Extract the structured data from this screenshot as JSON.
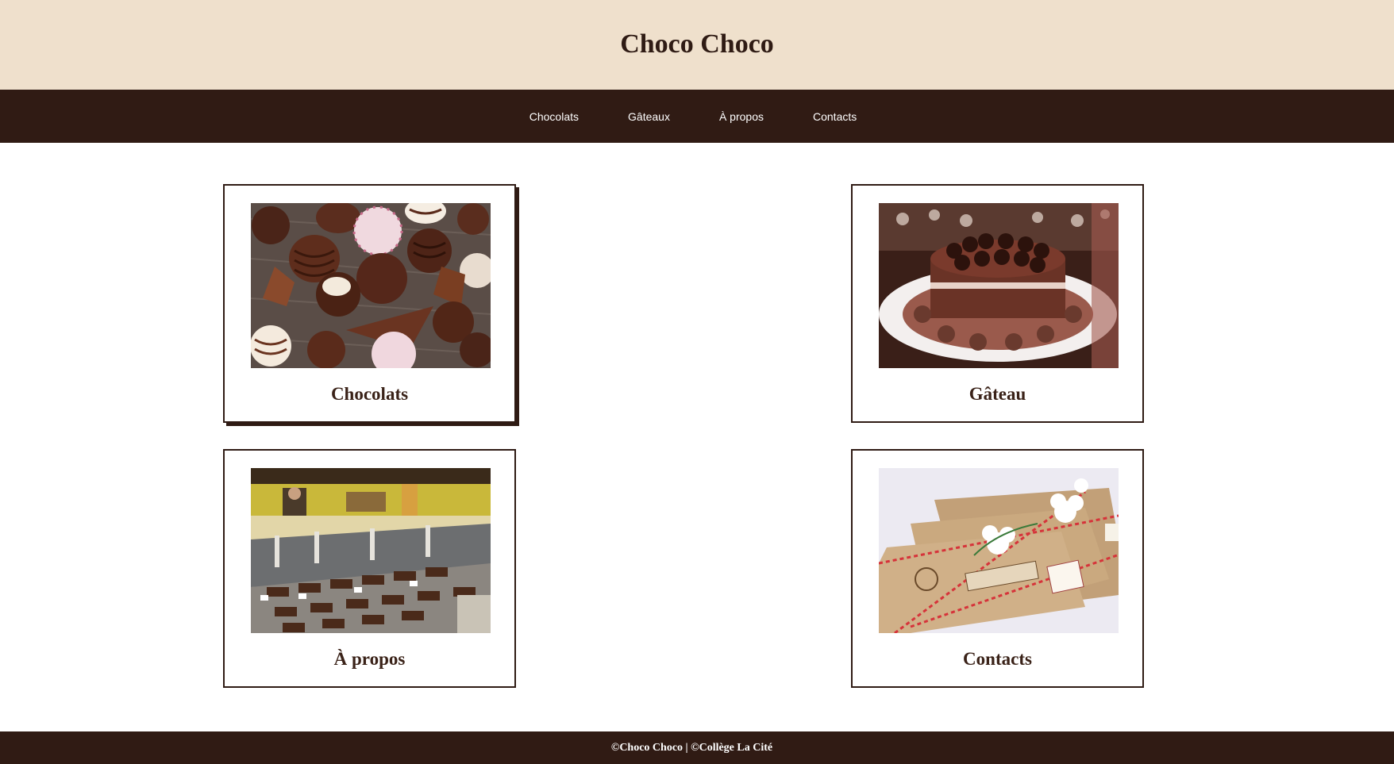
{
  "header": {
    "title": "Choco Choco"
  },
  "nav": {
    "items": [
      {
        "label": "Chocolats"
      },
      {
        "label": "Gâteaux"
      },
      {
        "label": "À propos"
      },
      {
        "label": "Contacts"
      }
    ]
  },
  "cards": [
    {
      "label": "Chocolats",
      "image": "chocolates-photo"
    },
    {
      "label": "Gâteau",
      "image": "chocolate-cake-photo"
    },
    {
      "label": "À propos",
      "image": "chocolate-shop-display-photo"
    },
    {
      "label": "Contacts",
      "image": "wrapped-chocolate-bars-photo"
    }
  ],
  "footer": {
    "text": "©Choco Choco | ©Collège La Cité"
  },
  "colors": {
    "header_bg": "#efe0cc",
    "nav_bg": "#301b14",
    "text_dark": "#2f1b14",
    "footer_bg": "#301b14"
  }
}
